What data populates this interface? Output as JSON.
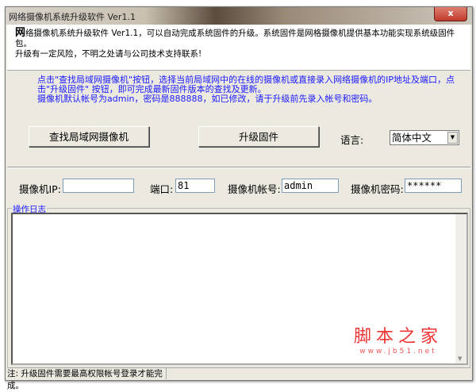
{
  "window": {
    "title": "网络摄像机系统升级软件 Ver1.1",
    "close_label": "x"
  },
  "header": {
    "first_char": "网",
    "line1_rest": "络摄像机系统升级软件 Ver1.1，可以自动完成系统固件的升级。系统固件是网格摄像机提供基本功能实现系统级固件包。",
    "line2": "升级有一定风险，不明之处请与公司技术支持联系!"
  },
  "instructions": {
    "line1": "点击\"查找局域网摄像机\"按钮，选择当前局域网中的在线的摄像机或直接录入网络摄像机的IP地址及端口，点击\"升级固件\" 按钮，即可完成最新固件版本的查找及更新。",
    "line2": "摄像机默认帐号为admin，密码是888888，如已修改，请于升级前先录入帐号和密码。"
  },
  "buttons": {
    "find": "查找局域网摄像机",
    "upgrade": "升级固件"
  },
  "language": {
    "label": "语言:",
    "selected": "简体中文"
  },
  "fields": {
    "ip_label": "摄像机IP:",
    "ip_value": "",
    "port_label": "端口:",
    "port_value": "81",
    "account_label": "摄像机帐号:",
    "account_value": "admin",
    "password_label": "摄像机密码:",
    "password_value": "******"
  },
  "log": {
    "title": "操作日志"
  },
  "watermark": {
    "name": "脚本之家",
    "url": "www.jb51.net"
  },
  "status": {
    "note": "注: 升级固件需要最高权限帐号登录才能完成。"
  }
}
